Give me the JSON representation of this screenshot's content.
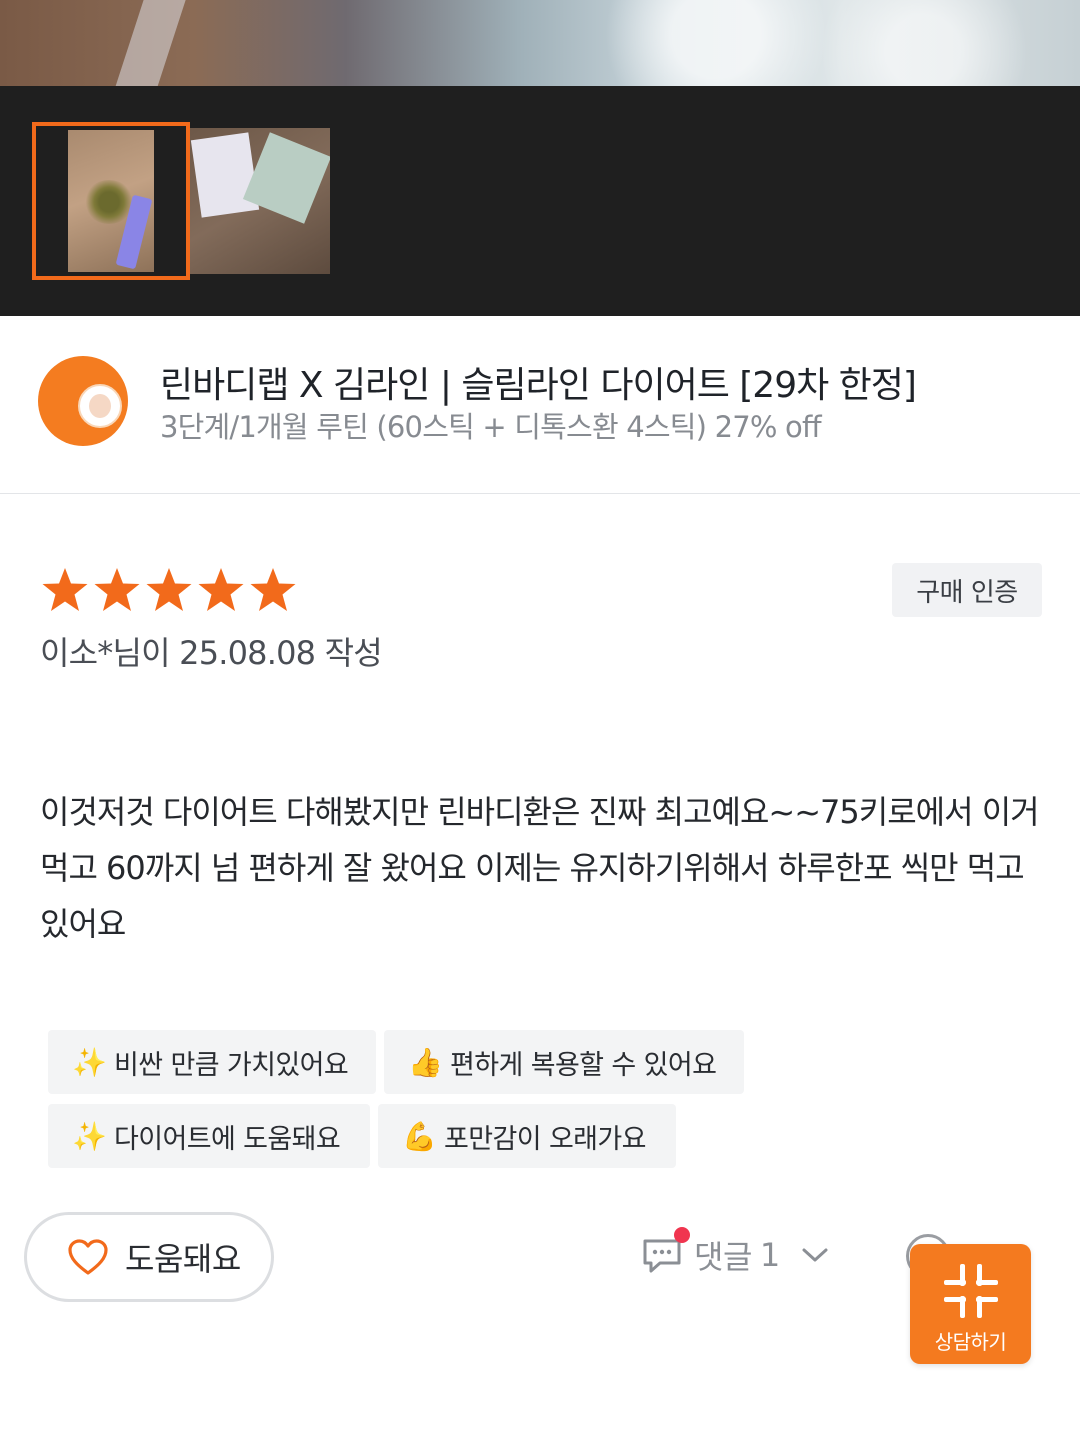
{
  "product": {
    "title": "린바디랩 X 김라인 | 슬림라인 다이어트 [29차 한정]",
    "subtitle": "3단계/1개월 루틴 (60스틱 + 디톡스환 4스틱) 27% off",
    "logo_icon": "brand-logo-icon"
  },
  "review": {
    "rating": 5,
    "rating_max": 5,
    "star_color": "#f26a1b",
    "verified_label": "구매 인증",
    "reviewer_line": "이소*님이 25.08.08 작성",
    "body": "이것저것 다이어트 다해봤지만 린바디환은 진짜 최고예요~~75키로에서 이거먹고 60까지 넘 편하게 잘 왔어요 이제는 유지하기위해서 하루한포 씩만 먹고 있어요",
    "tags": [
      {
        "icon": "✨",
        "label": "비싼 만큼 가치있어요"
      },
      {
        "icon": "👍",
        "label": "편하게 복용할 수 있어요"
      },
      {
        "icon": "✨",
        "label": "다이어트에 도움돼요"
      },
      {
        "icon": "💪",
        "label": "포만감이 오래가요"
      }
    ]
  },
  "actions": {
    "helpful_label": "도움돼요",
    "comment_label": "댓글",
    "comment_count": "1",
    "consult_label": "상담하기"
  },
  "colors": {
    "accent": "#f26a1b",
    "fab": "#f47a1f",
    "notification_dot": "#f0354f"
  }
}
